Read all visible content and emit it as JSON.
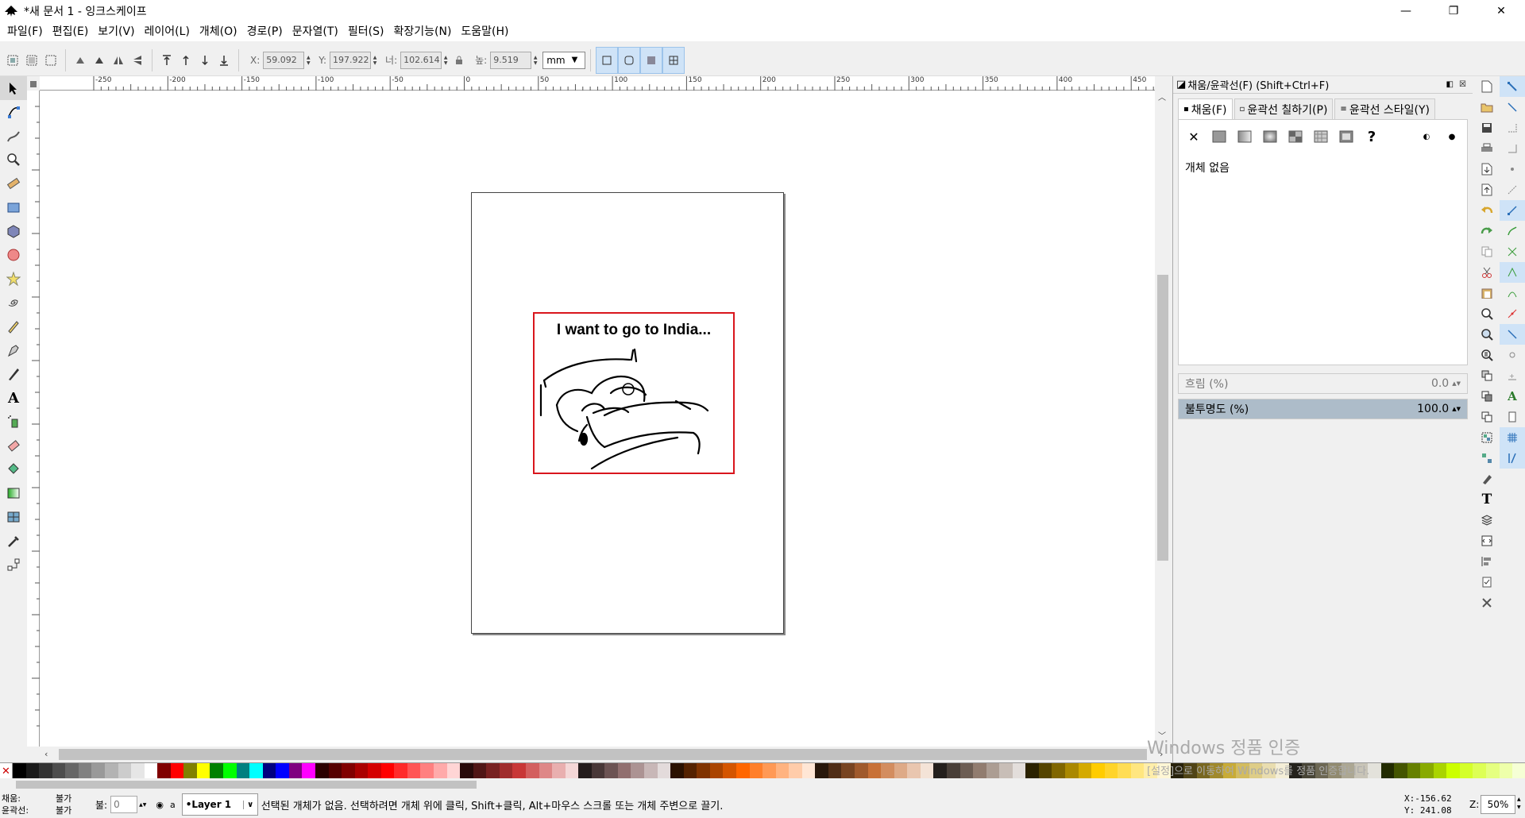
{
  "window": {
    "title": "*새 문서 1 - 잉크스케이프",
    "minimize": "—",
    "maximize": "❐",
    "close": "✕"
  },
  "menu": [
    "파일(F)",
    "편집(E)",
    "보기(V)",
    "레이어(L)",
    "개체(O)",
    "경로(P)",
    "문자열(T)",
    "필터(S)",
    "확장기능(N)",
    "도움말(H)"
  ],
  "toolbar": {
    "x_label": "X:",
    "x_value": "59.092",
    "y_label": "Y:",
    "y_value": "197.922",
    "w_label": "너:",
    "w_value": "102.614",
    "h_label": "높:",
    "h_value": "9.519",
    "unit": "mm"
  },
  "ruler": {
    "ticks": [
      "-250",
      "-200",
      "-150",
      "-100",
      "-50",
      "0",
      "50",
      "100",
      "150",
      "200",
      "250",
      "300",
      "350",
      "400",
      "450"
    ]
  },
  "canvas": {
    "image_caption": "I want to go to India..."
  },
  "panel": {
    "title": "채움/윤곽선(F) (Shift+Ctrl+F)",
    "tabs": [
      "채움(F)",
      "윤곽선 칠하기(P)",
      "윤곽선 스타일(Y)"
    ],
    "no_object": "개체 없음",
    "blur_label": "흐림 (%)",
    "blur_value": "0.0",
    "opacity_label": "불투명도 (%)",
    "opacity_value": "100.0",
    "opacity_fraction": 1.0
  },
  "status": {
    "fill_label": "채움:",
    "fill_value": "불가",
    "stroke_label": "윤곽선:",
    "stroke_value": "불가",
    "opacity_label": "불:",
    "opacity_value": "0",
    "layer": "•Layer 1",
    "message": "선택된 개체가 없음. 선택하려면 개체 위에 클릭, Shift+클릭, Alt+마우스 스크롤 또는 개체 주변으로 끌기.",
    "x_coord": "X:-156.62",
    "y_coord": "Y: 241.08",
    "zoom_label": "Z:",
    "zoom_value": "50%"
  },
  "watermark": {
    "line1": "Windows 정품 인증",
    "line2": "[설정]으로 이동하여 Windows를 정품 인증합니다."
  },
  "palette_colors": [
    "#000000",
    "#1a1a1a",
    "#333333",
    "#4d4d4d",
    "#666666",
    "#808080",
    "#999999",
    "#b3b3b3",
    "#cccccc",
    "#e6e6e6",
    "#ffffff",
    "#800000",
    "#ff0000",
    "#808000",
    "#ffff00",
    "#008000",
    "#00ff00",
    "#008080",
    "#00ffff",
    "#000080",
    "#0000ff",
    "#800080",
    "#ff00ff",
    "#2b0000",
    "#550000",
    "#800000",
    "#aa0000",
    "#d40000",
    "#ff0000",
    "#ff2a2a",
    "#ff5555",
    "#ff8080",
    "#ffaaaa",
    "#ffd5d5",
    "#280b0b",
    "#501616",
    "#782121",
    "#a02c2c",
    "#c83737",
    "#d35f5f",
    "#de8787",
    "#e9afaf",
    "#f4d7d7",
    "#241c1c",
    "#483737",
    "#6c5353",
    "#916f6f",
    "#ac9393",
    "#c8b7b7",
    "#e3dbdb",
    "#2b1100",
    "#552200",
    "#803300",
    "#aa4400",
    "#d45500",
    "#ff6600",
    "#ff7f2a",
    "#ff9955",
    "#ffb380",
    "#ffccaa",
    "#ffe6d5",
    "#28170b",
    "#502d16",
    "#784421",
    "#a05a2c",
    "#c87137",
    "#d38d5f",
    "#deaa87",
    "#e9c6af",
    "#f4e3d7",
    "#241f1c",
    "#483e37",
    "#6c5d53",
    "#917c6f",
    "#ac9d93",
    "#c8beb7",
    "#e3dedb",
    "#2b2200",
    "#554400",
    "#806600",
    "#aa8800",
    "#d4aa00",
    "#ffcc00",
    "#ffd42a",
    "#ffdd55",
    "#ffe680",
    "#ffeeaa",
    "#fff6d5",
    "#28220b",
    "#504416",
    "#786721",
    "#a0892c",
    "#c8ab37",
    "#d3bc5f",
    "#decd87",
    "#e9ddaf",
    "#f4eed7",
    "#24221c",
    "#484537",
    "#6c6753",
    "#918a6f",
    "#aca793",
    "#c8c4b7",
    "#e3e2db",
    "#222b00",
    "#445500",
    "#668000",
    "#88aa00",
    "#aad400",
    "#ccff00",
    "#d4ff2a",
    "#ddff55",
    "#e5ff80",
    "#eeffaa",
    "#f6ffd5"
  ]
}
